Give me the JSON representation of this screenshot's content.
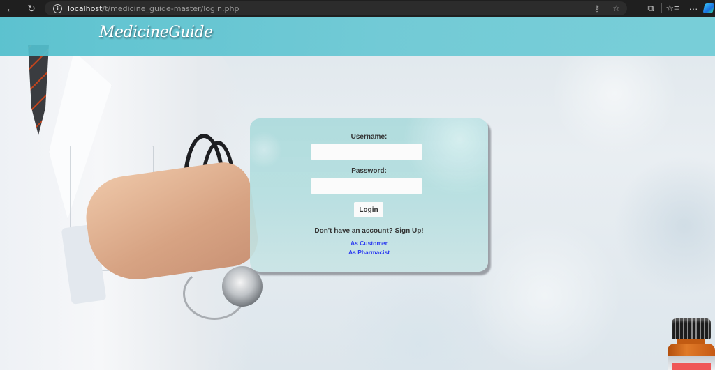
{
  "browser": {
    "url_host": "localhost",
    "url_path": "/t/medicine_guide-master/login.php",
    "icons": {
      "back": "back-arrow-icon",
      "reload": "reload-icon",
      "site_info": "info-icon",
      "key": "key-icon",
      "favorite": "star-icon",
      "extensions": "puzzle-icon",
      "favorites_list": "favorites-list-icon",
      "more": "more-icon",
      "copilot": "copilot-icon"
    },
    "glyphs": {
      "back": "←",
      "reload": "↻",
      "info": "i",
      "key": "⚷",
      "star": "☆",
      "extensions": "⧉",
      "favorites": "☆≡",
      "more": "···"
    }
  },
  "header": {
    "logo_text": "MedicineGuide",
    "color": "#5fc4d0"
  },
  "login": {
    "username_label": "Username:",
    "username_value": "",
    "username_placeholder": "",
    "password_label": "Password:",
    "password_value": "",
    "password_placeholder": "",
    "login_button": "Login",
    "signup_prompt": "Don't have an account? Sign Up!",
    "links": [
      {
        "label": "As Customer"
      },
      {
        "label": "As Pharmacist"
      }
    ],
    "link_color": "#2e3ef0"
  }
}
